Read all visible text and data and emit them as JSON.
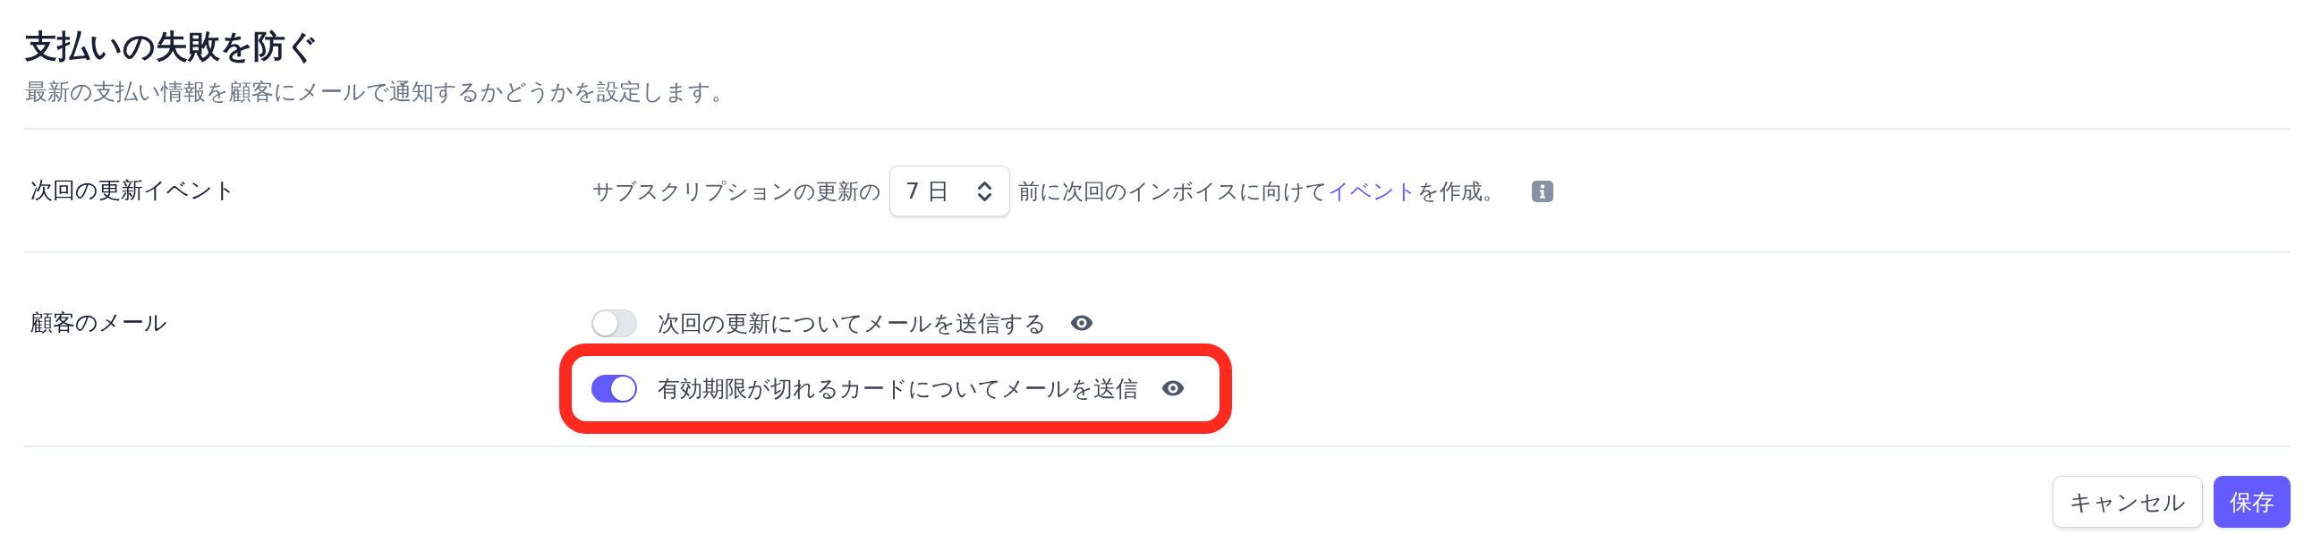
{
  "header": {
    "title": "支払いの失敗を防ぐ",
    "description": "最新の支払い情報を顧客にメールで通知するかどうかを設定します。"
  },
  "settings": [
    {
      "kind": "event",
      "label": "次回の更新イベント",
      "text_before": "サブスクリプションの更新の",
      "select": {
        "value": "7 日"
      },
      "text_middle": "前に次回のインボイスに向けて",
      "link": "イベント",
      "text_after": "を作成。"
    },
    {
      "kind": "toggles",
      "label": "顧客のメール",
      "toggles": [
        {
          "label": "次回の更新についてメールを送信する",
          "on": false,
          "highlighted": false
        },
        {
          "label": "有効期限が切れるカードについてメールを送信",
          "on": true,
          "highlighted": true
        }
      ]
    }
  ],
  "buttons": [
    {
      "label": "キャンセル",
      "kind": "secondary"
    },
    {
      "label": "保存",
      "kind": "primary"
    }
  ]
}
